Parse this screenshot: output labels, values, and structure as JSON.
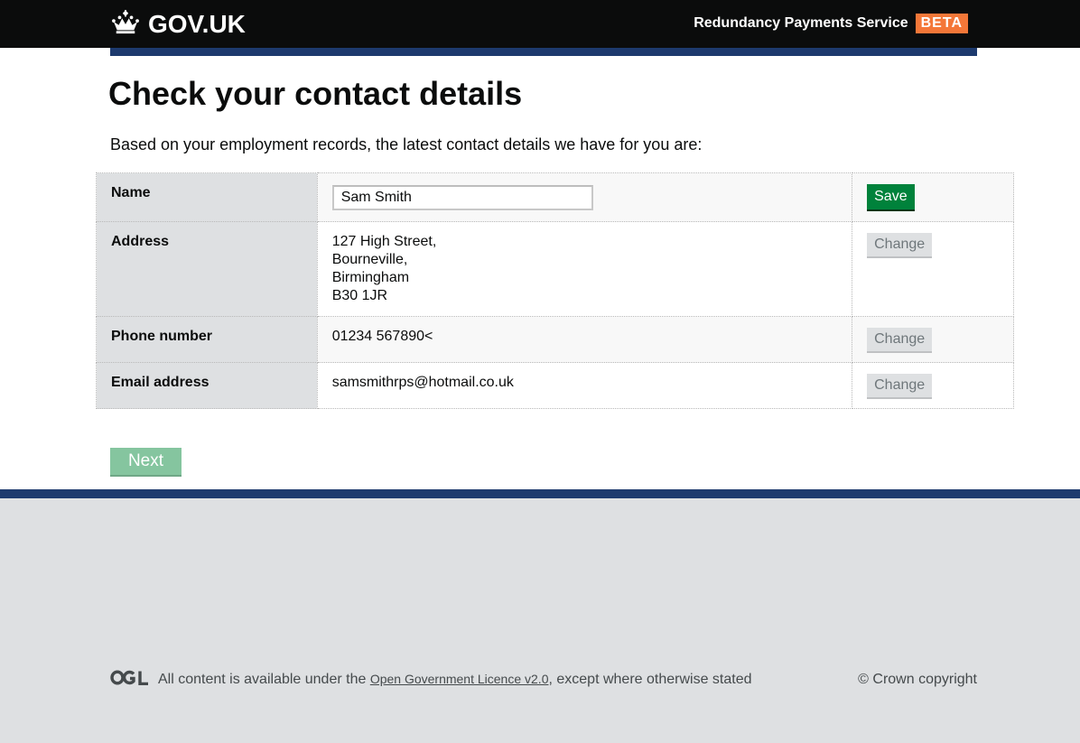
{
  "header": {
    "logo_text": "GOV.UK",
    "service_name": "Redundancy Payments Service",
    "phase_tag": "BETA"
  },
  "page": {
    "title": "Check your contact details",
    "lead": "Based on your employment records, the latest contact details we have for you are:"
  },
  "details": {
    "name": {
      "label": "Name",
      "value": "Sam Smith",
      "action": "Save"
    },
    "address": {
      "label": "Address",
      "lines": [
        "127 High Street,",
        "Bourneville,",
        "Birmingham",
        "B30 1JR"
      ],
      "action": "Change"
    },
    "phone": {
      "label": "Phone number",
      "value": "01234 567890<",
      "action": "Change"
    },
    "email": {
      "label": "Email address",
      "value": "samsmithrps@hotmail.co.uk",
      "action": "Change"
    }
  },
  "next_button": "Next",
  "footer": {
    "licence_prefix": "All content is available under the ",
    "licence_link": "Open Government Licence v2.0",
    "licence_suffix": ", except where otherwise stated",
    "copyright": "© Crown copyright"
  },
  "colors": {
    "header_bg": "#0b0c0c",
    "stripe": "#1d3a6e",
    "beta_tag": "#f47738",
    "save_button": "#00823b",
    "next_button": "#85c59f",
    "footer_bg": "#dee0e2"
  },
  "icons": {
    "logo": "crown-icon",
    "licence": "ogl-logo-icon"
  }
}
